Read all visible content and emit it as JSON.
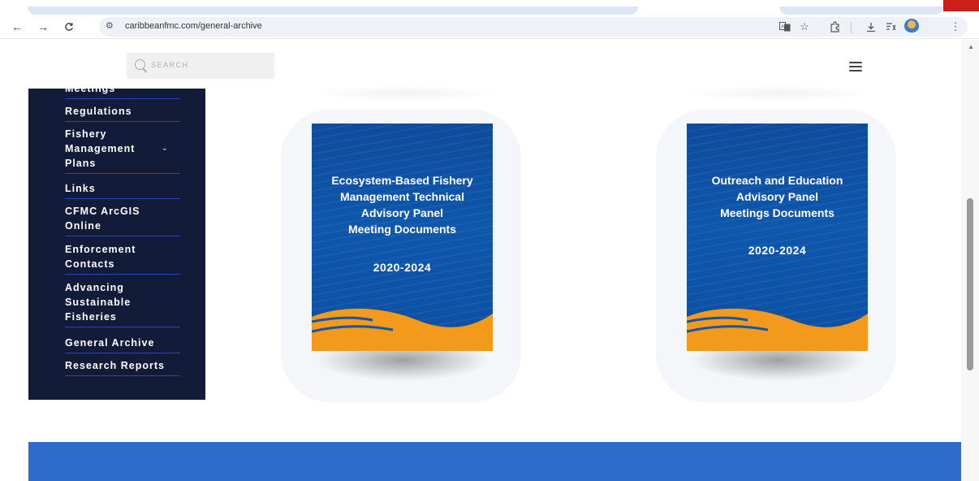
{
  "browser": {
    "url": "caribbeanfmc.com/general-archive",
    "nav": {
      "back": "←",
      "forward": "→",
      "reload": "C"
    },
    "site_info_icon": "tune-icon",
    "toolbar_icons": [
      "translate-icon",
      "star-icon",
      "extensions-icon",
      "download-icon",
      "reading-list-icon",
      "profile-avatar",
      "more-icon"
    ]
  },
  "header": {
    "search_placeholder": "SEARCH"
  },
  "sidebar": {
    "items": [
      {
        "label": "Meetings"
      },
      {
        "label": "Regulations"
      },
      {
        "label": "Fishery Management Plans",
        "has_submenu": true
      },
      {
        "label": "Links"
      },
      {
        "label": "CFMC ArcGIS Online"
      },
      {
        "label": "Enforcement Contacts"
      },
      {
        "label": "Advancing Sustainable Fisheries"
      },
      {
        "label": "General Archive"
      },
      {
        "label": "Research Reports"
      }
    ],
    "line_labels": {
      "fmp": [
        "Fishery",
        "Management",
        "Plans"
      ],
      "arcgis": [
        "CFMC ArcGIS",
        "Online"
      ],
      "enforcement": [
        "Enforcement",
        "Contacts"
      ],
      "advancing": [
        "Advancing",
        "Sustainable",
        "Fisheries"
      ]
    }
  },
  "cards": [
    {
      "title_lines": [
        "Ecosystem-Based Fishery",
        "Management Technical",
        "Advisory Panel",
        "Meeting Documents"
      ],
      "years": "2020-2024"
    },
    {
      "title_lines": [
        "Outreach and Education",
        "Advisory Panel",
        "Meetings Documents"
      ],
      "years": "2020-2024"
    }
  ],
  "colors": {
    "sidebar_bg": "#121c38",
    "sidebar_divider": "#2c44b8",
    "card_blue": "#0d57ad",
    "card_orange": "#f39a1c",
    "footer_blue": "#2e6ccc"
  }
}
